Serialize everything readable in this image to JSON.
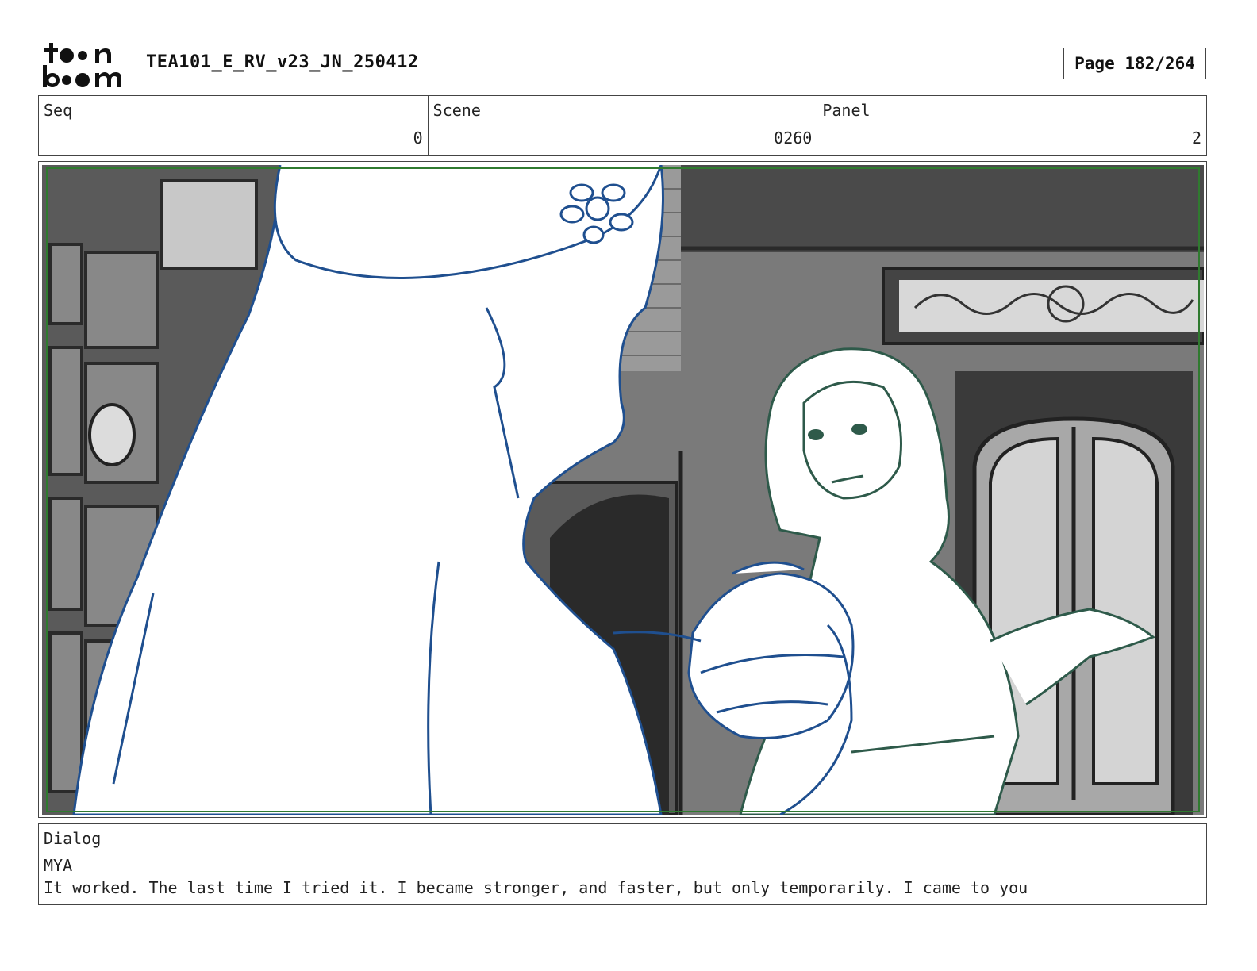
{
  "header": {
    "logo_text": "toon boom",
    "doc_title": "TEA101_E_RV_v23_JN_250412",
    "page_label": "Page 182/264"
  },
  "info": {
    "seq_label": "Seq",
    "seq_value": "0",
    "scene_label": "Scene",
    "scene_value": "0260",
    "panel_label": "Panel",
    "panel_value": "2"
  },
  "dialog": {
    "label": "Dialog",
    "speaker": "MYA",
    "text": "It worked. The last time I tried it. I became stronger, and faster, but only temporarily. I came to you"
  },
  "colors": {
    "foreground_line": "#1f4f8f",
    "character_line": "#2e5a4a",
    "safe_frame": "#2f7a2f",
    "background_gray": "#6a6a6a"
  }
}
